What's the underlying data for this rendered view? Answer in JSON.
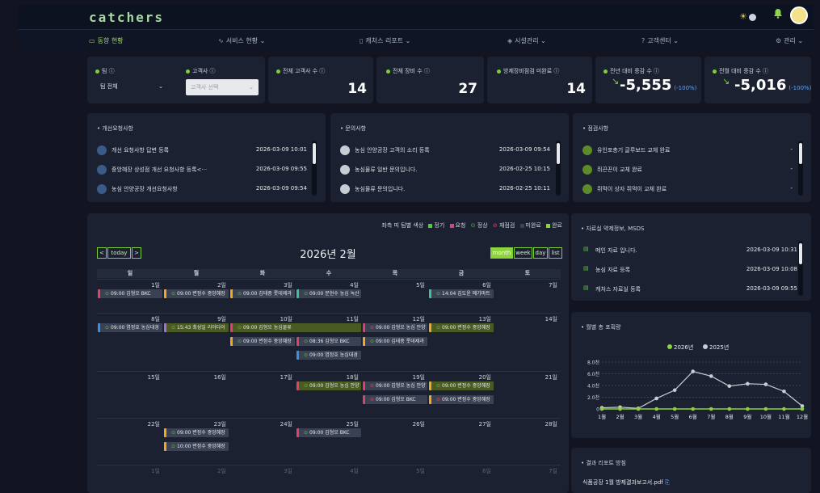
{
  "app": {
    "name": "catchers"
  },
  "nav": [
    {
      "label": "동향 현황",
      "icon": "monitor-icon",
      "active": true
    },
    {
      "label": "서비스 현황",
      "icon": "activity-icon"
    },
    {
      "label": "캐처스 리포트",
      "icon": "clipboard-icon"
    },
    {
      "label": "시설관리",
      "icon": "layers-icon"
    },
    {
      "label": "고객센터",
      "icon": "help-icon"
    },
    {
      "label": "관리",
      "icon": "gear-icon"
    }
  ],
  "filters": {
    "team_label": "팀",
    "team_value": "팀 전체",
    "client_label": "고객사",
    "client_placeholder": "고객사 선택"
  },
  "stats": [
    {
      "label": "전체 고객사 수",
      "value": "14"
    },
    {
      "label": "전체 장비 수",
      "value": "27"
    },
    {
      "label": "방제장비점검 미완료",
      "value": "14"
    },
    {
      "label": "전년 대비 증감 수",
      "value": "-5,555",
      "pct": "(-100%)"
    },
    {
      "label": "전월 대비 증감 수",
      "value": "-5,016",
      "pct": "(-100%)"
    }
  ],
  "improvement": {
    "title": "개선요청사항",
    "items": [
      {
        "title": "개선 요청사항 답변 등록",
        "date": "2026-03-09 10:01"
      },
      {
        "title": "중앙혜장 상성점 개선 요청사항 등록<···",
        "date": "2026-03-09 09:55"
      },
      {
        "title": "농심 안양공장 개선요청사항",
        "date": "2026-03-09 09:54"
      }
    ]
  },
  "inquiry": {
    "title": "문의사항",
    "items": [
      {
        "title": "농심 안양공장 고객의 소리 등록",
        "date": "2026-03-09 09:54"
      },
      {
        "title": "농심물류 일반 문의입니다.",
        "date": "2026-02-25 10:15"
      },
      {
        "title": "농심물류 문의입니다.",
        "date": "2026-02-25 10:11"
      }
    ]
  },
  "inspection": {
    "title": "점검사항",
    "items": [
      {
        "title": "유인포충기 글루보드 교체 완료",
        "date": "-"
      },
      {
        "title": "쥐끈끈이 교체 완료",
        "date": "-"
      },
      {
        "title": "쥐먹이 상자 쥐먹이 교체 완료",
        "date": "-"
      }
    ]
  },
  "calendar": {
    "legend_prefix": "좌측 띠 팀별 색상",
    "legend": [
      {
        "label": "정기",
        "color": "#5cc24a"
      },
      {
        "label": "요청",
        "color": "#e0416a"
      },
      {
        "label": "정상",
        "color": "#5cc24a",
        "icon": "check-circle"
      },
      {
        "label": "재점검",
        "color": "#e0416a",
        "icon": "alert-circle"
      },
      {
        "label": "미완료",
        "color": "#3a4152"
      },
      {
        "label": "완료",
        "color": "#8ed23c"
      }
    ],
    "title": "2026년 2월",
    "today_label": "today",
    "prev": "<",
    "next": ">",
    "views": [
      "month",
      "week",
      "day",
      "list"
    ],
    "weekdays": [
      "일",
      "월",
      "화",
      "수",
      "목",
      "금",
      "토"
    ],
    "weeks": [
      {
        "days": [
          "1일",
          "2일",
          "3일",
          "4일",
          "5일",
          "6일",
          "7일"
        ],
        "faded": false
      },
      {
        "days": [
          "8일",
          "9일",
          "10일",
          "11일",
          "12일",
          "13일",
          "14일"
        ],
        "faded": false
      },
      {
        "days": [
          "15일",
          "16일",
          "17일",
          "18일",
          "19일",
          "20일",
          "21일"
        ],
        "faded": false
      },
      {
        "days": [
          "22일",
          "23일",
          "24일",
          "25일",
          "26일",
          "27일",
          "28일"
        ],
        "faded": false
      },
      {
        "days": [
          "1일",
          "2일",
          "3일",
          "4일",
          "5일",
          "6일",
          "7일"
        ],
        "faded": true
      }
    ],
    "events": [
      {
        "week": 0,
        "day": 0,
        "slot": 0,
        "span": 1,
        "text": "09:00 김형오 BKC",
        "icon": "✓",
        "strip": "#e0416a",
        "bg": "#3a4152"
      },
      {
        "week": 0,
        "day": 1,
        "slot": 0,
        "span": 1,
        "text": "09:00 변정수 중앙혜장",
        "icon": "✓",
        "strip": "#f0a81e",
        "bg": "#3a4152"
      },
      {
        "week": 0,
        "day": 2,
        "slot": 0,
        "span": 1,
        "text": "09:00 김태중 롯데제과",
        "icon": "✓",
        "strip": "#f0a81e",
        "bg": "#3a4152"
      },
      {
        "week": 0,
        "day": 3,
        "slot": 0,
        "span": 1,
        "text": "09:00 문현수 농심 녹산",
        "icon": "✓",
        "strip": "#3cc0a0",
        "bg": "#3a4152"
      },
      {
        "week": 0,
        "day": 5,
        "slot": 0,
        "span": 1,
        "text": "14:04 김도윤 메가마트",
        "icon": "✓",
        "strip": "#3cc0a0",
        "bg": "#3a4152"
      },
      {
        "week": 1,
        "day": 0,
        "slot": 0,
        "span": 1,
        "text": "09:00 염정호 농심대경",
        "icon": "✓",
        "strip": "#3d8de0",
        "bg": "#3a4152"
      },
      {
        "week": 1,
        "day": 1,
        "slot": 0,
        "span": 1,
        "text": "15:43 최성일 리아다이",
        "icon": "✓",
        "strip": "#a070e0",
        "bg": "#4a5a22"
      },
      {
        "week": 1,
        "day": 2,
        "slot": 0,
        "span": 2,
        "text": "09:00 김형오 농심물류",
        "icon": "✓",
        "strip": "#e0416a",
        "bg": "#4a5a22"
      },
      {
        "week": 1,
        "day": 4,
        "slot": 0,
        "span": 1,
        "text": "09:00 김형오 농심 안양",
        "icon": "!",
        "strip": "#e0416a",
        "bg": "#3a4152"
      },
      {
        "week": 1,
        "day": 5,
        "slot": 0,
        "span": 1,
        "text": "09:00 변정수 중앙혜장",
        "icon": "✓",
        "strip": "#f0a81e",
        "bg": "#4a5a22"
      },
      {
        "week": 1,
        "day": 2,
        "slot": 1,
        "span": 1,
        "text": "09:00 변정수 중앙혜장",
        "icon": "✓",
        "strip": "#f0a81e",
        "bg": "#3a4152"
      },
      {
        "week": 1,
        "day": 3,
        "slot": 1,
        "span": 1,
        "text": "08:36 김형오 BKC",
        "icon": "✓",
        "strip": "#e0416a",
        "bg": "#3a4152"
      },
      {
        "week": 1,
        "day": 4,
        "slot": 1,
        "span": 1,
        "text": "09:00 김태중 롯데제과",
        "icon": "✓",
        "strip": "#f0a81e",
        "bg": "#3a4152"
      },
      {
        "week": 1,
        "day": 3,
        "slot": 2,
        "span": 1,
        "text": "09:00 염정호 농심대경",
        "icon": "✓",
        "strip": "#3d8de0",
        "bg": "#3a4152"
      },
      {
        "week": 2,
        "day": 3,
        "slot": 0,
        "span": 1,
        "text": "09:00 김형오 농심 안양",
        "icon": "✓",
        "strip": "#e0416a",
        "bg": "#4a5a22"
      },
      {
        "week": 2,
        "day": 4,
        "slot": 0,
        "span": 1,
        "text": "09:00 김형오 농심 안양",
        "icon": "!",
        "strip": "#e0416a",
        "bg": "#3a4152"
      },
      {
        "week": 2,
        "day": 5,
        "slot": 0,
        "span": 1,
        "text": "09:00 변정수 중앙혜장",
        "icon": "✓",
        "strip": "#f0a81e",
        "bg": "#4a5a22"
      },
      {
        "week": 2,
        "day": 4,
        "slot": 1,
        "span": 1,
        "text": "09:00 김형오 BKC",
        "icon": "!",
        "strip": "#e0416a",
        "bg": "#3a4152"
      },
      {
        "week": 2,
        "day": 5,
        "slot": 1,
        "span": 1,
        "text": "09:00 변정수 중앙혜장",
        "icon": "!",
        "strip": "#f0a81e",
        "bg": "#3a4152"
      },
      {
        "week": 3,
        "day": 1,
        "slot": 0,
        "span": 1,
        "text": "09:00 변정수 중앙혜장",
        "icon": "✓",
        "strip": "#f0a81e",
        "bg": "#3a4152"
      },
      {
        "week": 3,
        "day": 3,
        "slot": 0,
        "span": 1,
        "text": "09:00 김형오 BKC",
        "icon": "✓",
        "strip": "#e0416a",
        "bg": "#3a4152"
      },
      {
        "week": 3,
        "day": 1,
        "slot": 1,
        "span": 1,
        "text": "10:00 변정수 중앙혜장",
        "icon": "✓",
        "strip": "#f0a81e",
        "bg": "#3a4152"
      }
    ]
  },
  "msds": {
    "title": "자료실 약제정보, MSDS",
    "items": [
      {
        "title": "메인 자료 입니다.",
        "date": "2026-03-09 10:31"
      },
      {
        "title": "농심 자료 등록",
        "date": "2026-03-09 10:08"
      },
      {
        "title": "캐처스 자료실 등록",
        "date": "2026-03-09 09:55"
      }
    ]
  },
  "monthly_chart": {
    "title": "월별 총 포획량"
  },
  "report": {
    "title": "결과 리포트 방침",
    "file": "식품공장 1월 방제결과보고서.pdf"
  },
  "chart_data": {
    "type": "line",
    "title": "월별 총 포획량",
    "x": [
      "1월",
      "2월",
      "3월",
      "4월",
      "5월",
      "6월",
      "7월",
      "8월",
      "9월",
      "10월",
      "11월",
      "12월"
    ],
    "y_ticks": [
      "0",
      "2.0천",
      "4.0천",
      "6.0천",
      "8.0천"
    ],
    "ylim": [
      0,
      8000
    ],
    "series": [
      {
        "name": "2026년",
        "color": "#8ed23c",
        "values": [
          0,
          0,
          0,
          0,
          0,
          0,
          0,
          0,
          0,
          0,
          0,
          0
        ]
      },
      {
        "name": "2025년",
        "color": "#c8ccd4",
        "values": [
          200,
          300,
          100,
          1800,
          3200,
          6400,
          5600,
          3900,
          4300,
          4200,
          3000,
          500
        ]
      }
    ],
    "legend": "top-center"
  }
}
